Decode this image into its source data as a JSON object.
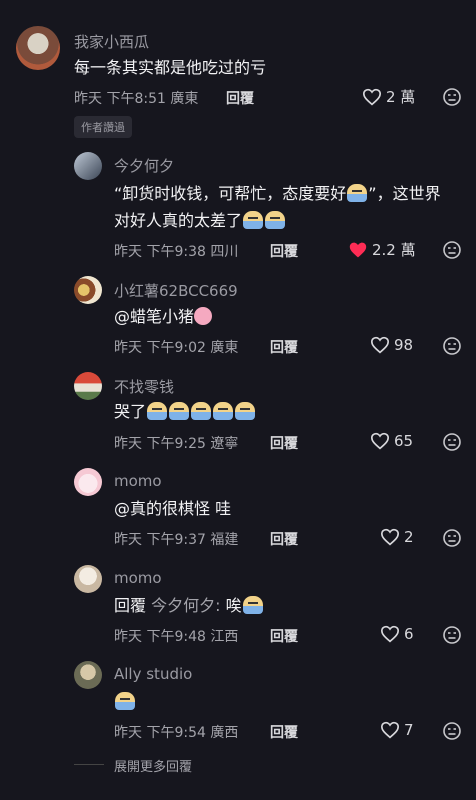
{
  "comments": [
    {
      "name": "我家小西瓜",
      "text": "每一条其实都是他吃过的亏",
      "meta": "昨天 下午8:51 廣東",
      "reply": "回覆",
      "likes": "2 萬",
      "badge": "作者讚過",
      "liked": false
    },
    {
      "name": "今夕何夕",
      "text_line1_a": "“卸货时收钱，可帮忙，态度要好",
      "text_line1_b": "”，这世界",
      "text_line2": "对好人真的太差了",
      "meta": "昨天 下午9:38 四川",
      "reply": "回覆",
      "likes": "2.2 萬",
      "liked": true
    },
    {
      "name": "小红薯62BCC669",
      "text": "@蜡笔小猪",
      "meta": "昨天 下午9:02 廣東",
      "reply": "回覆",
      "likes": "98",
      "liked": false
    },
    {
      "name": "不找零钱",
      "text": "哭了",
      "meta": "昨天 下午9:25 遼寧",
      "reply": "回覆",
      "likes": "65",
      "liked": false
    },
    {
      "name": "momo",
      "text": "@真的很棋怪 哇",
      "meta": "昨天 下午9:37 福建",
      "reply": "回覆",
      "likes": "2",
      "liked": false
    },
    {
      "name": "momo",
      "text_prefix": "回覆",
      "text_target": "今夕何夕:",
      "text_body": "唉",
      "meta": "昨天 下午9:48 江西",
      "reply": "回覆",
      "likes": "6",
      "liked": false
    },
    {
      "name": "Ally studio",
      "meta": "昨天 下午9:54 廣西",
      "reply": "回覆",
      "likes": "7",
      "liked": false
    }
  ],
  "show_more": "展開更多回覆",
  "colors": {
    "background": "#16161e",
    "like_red": "#fe2c55",
    "muted": "#a3a3aa"
  },
  "icons": [
    "heart-icon",
    "heart-filled-icon",
    "sad-face-icon",
    "pig-emoji-icon",
    "crying-emoji-icon"
  ]
}
